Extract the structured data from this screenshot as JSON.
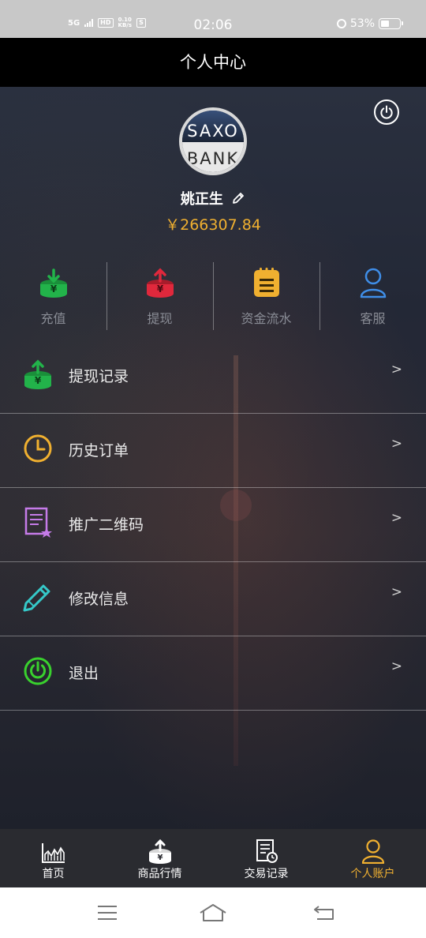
{
  "status_bar": {
    "network": "5G",
    "hd": "HD",
    "speed_value": "0.10",
    "speed_unit": "KB/s",
    "app_badge": "S",
    "time": "02:06",
    "battery": "53%"
  },
  "header": {
    "title": "个人中心"
  },
  "profile": {
    "avatar_top": "SAXO",
    "avatar_bottom": "BANK",
    "name": "姚正生",
    "balance": "￥266307.84"
  },
  "quick_actions": [
    {
      "label": "充值",
      "icon": "deposit-icon",
      "color": "#22b34a"
    },
    {
      "label": "提现",
      "icon": "withdraw-icon",
      "color": "#e0283c"
    },
    {
      "label": "资金流水",
      "icon": "fund-flow-icon",
      "color": "#f0b030"
    },
    {
      "label": "客服",
      "icon": "customer-service-icon",
      "color": "#3f8ee8"
    }
  ],
  "menu": [
    {
      "label": "提现记录",
      "arrow": ">",
      "icon": "withdraw-record-icon",
      "color": "#22b34a"
    },
    {
      "label": "历史订单",
      "arrow": ">",
      "icon": "clock-icon",
      "color": "#f0b030"
    },
    {
      "label": "推广二维码",
      "arrow": ">",
      "icon": "qrcode-doc-icon",
      "color": "#c57be8"
    },
    {
      "label": "修改信息",
      "arrow": ">",
      "icon": "pencil-icon",
      "color": "#35c8c8"
    },
    {
      "label": "退出",
      "arrow": ">",
      "icon": "power-icon",
      "color": "#39d12e"
    }
  ],
  "tabs": [
    {
      "label": "首页",
      "icon": "chart-icon",
      "active": false
    },
    {
      "label": "商品行情",
      "icon": "yen-box-icon",
      "active": false
    },
    {
      "label": "交易记录",
      "icon": "records-icon",
      "active": false
    },
    {
      "label": "个人账户",
      "icon": "person-icon",
      "active": true
    }
  ],
  "colors": {
    "accent": "#f0b030",
    "header_bg": "#000000",
    "tabbar_bg": "#2a2b30"
  }
}
